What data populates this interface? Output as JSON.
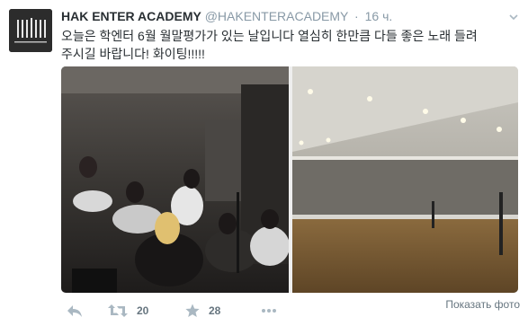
{
  "tweet": {
    "fullname": "HAK ENTER ACADEMY",
    "username": "@HAKENTERACADEMY",
    "separator": "·",
    "time": "16 ч.",
    "text_line1": "오늘은 학엔터 6월 월말평가가 있는 날입니다 열심히 한만큼 다들 좋은 노래 들려",
    "text_line2": "주시길 바랍니다! 화이팅!!!!!",
    "show_photo": "Показать фото",
    "retweet_count": "20",
    "favorite_count": "28"
  },
  "icons": {
    "reply": "reply-icon",
    "retweet": "retweet-icon",
    "favorite": "star-icon",
    "more": "more-icon",
    "caret": "chevron-down-icon"
  },
  "colors": {
    "text": "#292f33",
    "muted": "#8899a6",
    "action": "#aab8c2"
  }
}
